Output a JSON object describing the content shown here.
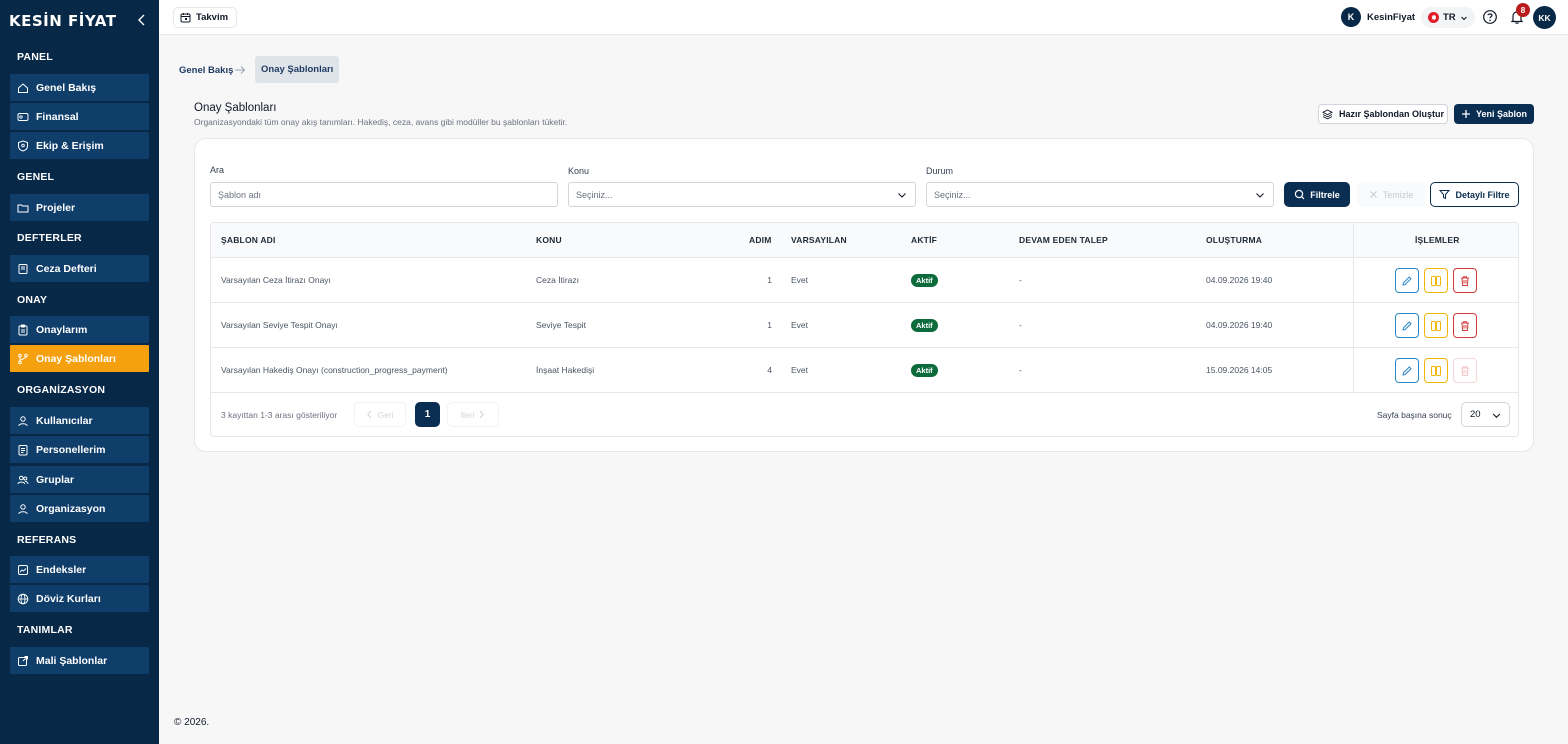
{
  "brand": {
    "logo_text": "KESİN FİYAT"
  },
  "sidebar": {
    "sections": [
      {
        "title": "PANEL",
        "items": [
          {
            "label": "Genel Bakış",
            "icon": "home-icon"
          },
          {
            "label": "Finansal",
            "icon": "wallet-icon"
          },
          {
            "label": "Ekip & Erişim",
            "icon": "shield-icon"
          }
        ]
      },
      {
        "title": "GENEL",
        "items": [
          {
            "label": "Projeler",
            "icon": "folder-icon"
          }
        ]
      },
      {
        "title": "DEFTERLER",
        "items": [
          {
            "label": "Ceza Defteri",
            "icon": "book-icon"
          }
        ]
      },
      {
        "title": "ONAY",
        "items": [
          {
            "label": "Onaylarım",
            "icon": "clipboard-icon"
          },
          {
            "label": "Onay Şablonları",
            "icon": "branch-icon",
            "active": true
          }
        ]
      },
      {
        "title": "ORGANİZASYON",
        "items": [
          {
            "label": "Kullanıcılar",
            "icon": "user-icon"
          },
          {
            "label": "Personellerim",
            "icon": "id-card-icon"
          },
          {
            "label": "Gruplar",
            "icon": "users-icon"
          },
          {
            "label": "Organizasyon",
            "icon": "org-icon"
          }
        ]
      },
      {
        "title": "REFERANS",
        "items": [
          {
            "label": "Endeksler",
            "icon": "chart-icon"
          },
          {
            "label": "Döviz Kurları",
            "icon": "globe-icon"
          }
        ]
      },
      {
        "title": "TANIMLAR",
        "items": [
          {
            "label": "Mali Şablonlar",
            "icon": "external-icon"
          }
        ]
      }
    ]
  },
  "topbar": {
    "calendar_label": "Takvim",
    "company_initial": "K",
    "company_name": "KesinFiyat",
    "language": "TR",
    "notification_count": "8",
    "user_initials": "KK"
  },
  "breadcrumb": {
    "parent": "Genel Bakış",
    "current": "Onay Şablonları"
  },
  "header": {
    "title": "Onay Şablonları",
    "subtitle": "Organizasyondaki tüm onay akış tanımları. Hakediş, ceza, avans gibi modüller bu şablonları tüketir.",
    "ready_template_button": "Hazır Şablondan Oluştur",
    "new_template_button": "Yeni Şablon"
  },
  "filters": {
    "search_label": "Ara",
    "search_placeholder": "Şablon adı",
    "subject_label": "Konu",
    "subject_value": "Seçiniz...",
    "status_label": "Durum",
    "status_value": "Seçiniz...",
    "filter_button": "Filtrele",
    "clear_button": "Temizle",
    "detail_filter_button": "Detaylı Filtre"
  },
  "table": {
    "columns": [
      "ŞABLON ADI",
      "KONU",
      "ADIM",
      "VARSAYILAN",
      "AKTİF",
      "DEVAM EDEN TALEP",
      "OLUŞTURMA",
      "İŞLEMLER"
    ],
    "rows": [
      {
        "name": "Varsayılan Ceza İtirazı Onayı",
        "subject": "Ceza İtirazı",
        "steps": "1",
        "default": "Evet",
        "active": "Aktif",
        "pending": "-",
        "created": "04.09.2026 19:40",
        "delete_enabled": true
      },
      {
        "name": "Varsayılan Seviye Tespit Onayı",
        "subject": "Seviye Tespit",
        "steps": "1",
        "default": "Evet",
        "active": "Aktif",
        "pending": "-",
        "created": "04.09.2026 19:40",
        "delete_enabled": true
      },
      {
        "name": "Varsayılan Hakediş Onayı (construction_progress_payment)",
        "subject": "İnşaat Hakedişi",
        "steps": "4",
        "default": "Evet",
        "active": "Aktif",
        "pending": "-",
        "created": "15.09.2026 14:05",
        "delete_enabled": false
      }
    ]
  },
  "pagination": {
    "summary": "3 kayıttan 1-3 arası gösteriliyor",
    "prev_label": "Geri",
    "current_page": "1",
    "next_label": "İleri",
    "per_page_label": "Sayfa başına sonuç",
    "per_page_value": "20"
  },
  "footer": {
    "copyright": "© 2026."
  },
  "colors": {
    "sidebar_bg": "#082847",
    "nav_item_bg": "#0f3e6b",
    "active_item": "#f5a10f",
    "primary": "#0a2e52",
    "success_pill": "#0b6b3a",
    "edit_border": "#2b86c7",
    "columns_border": "#f2b705",
    "delete_border": "#d33b3b"
  }
}
